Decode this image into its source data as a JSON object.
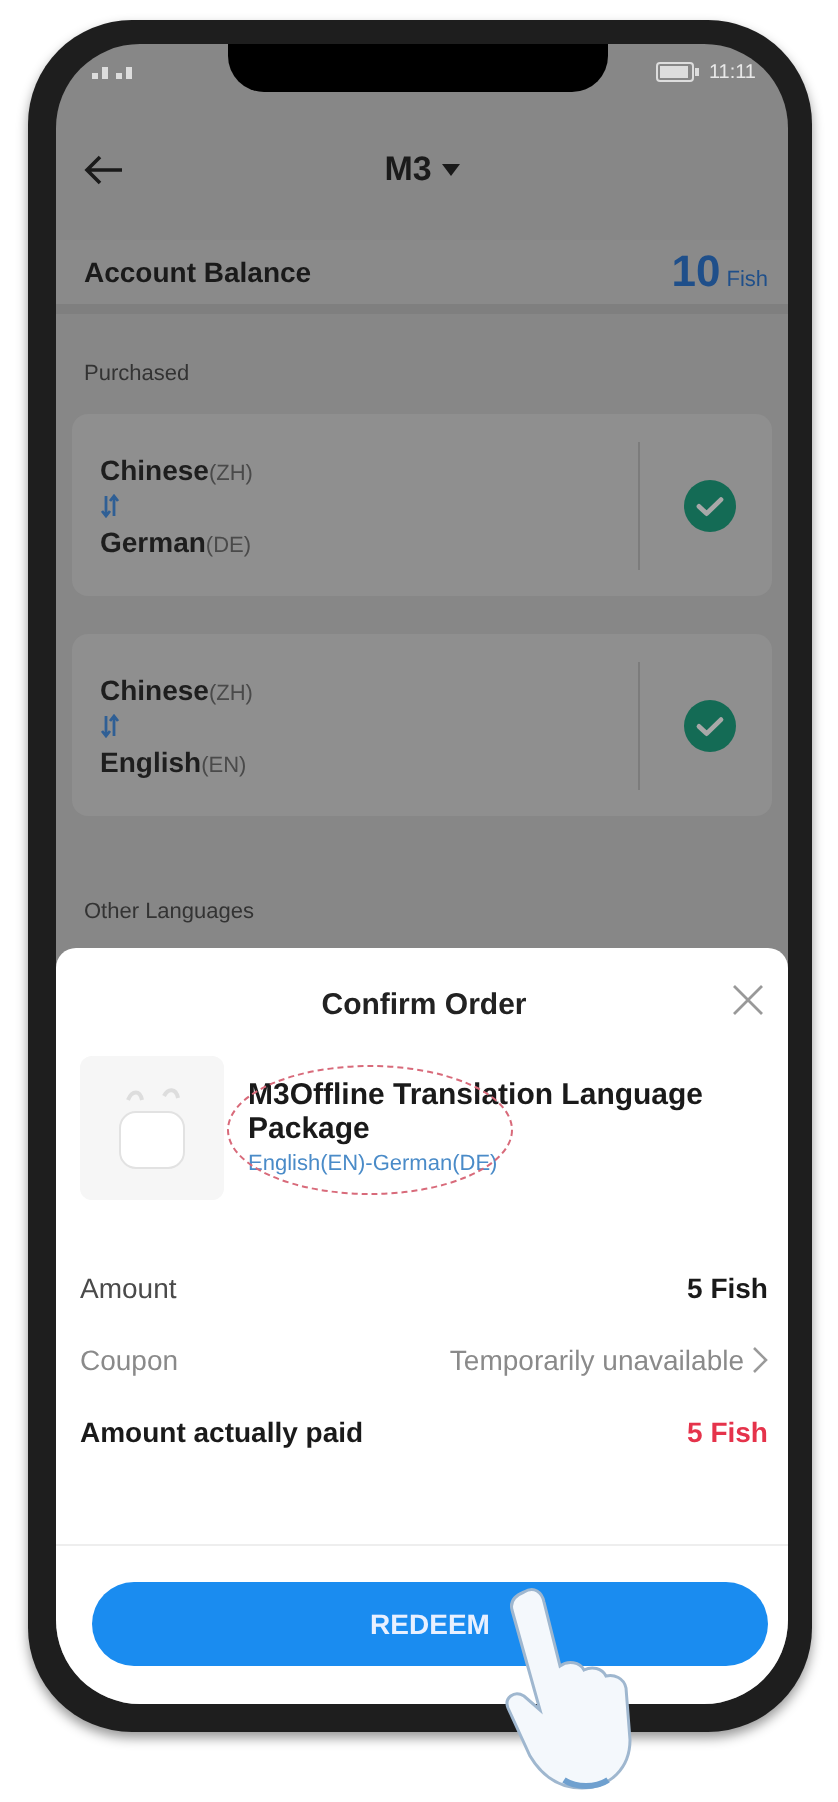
{
  "status_bar": {
    "time": "11:11"
  },
  "header": {
    "title": "M3"
  },
  "balance": {
    "label": "Account Balance",
    "amount": "10",
    "unit": "Fish"
  },
  "purchased": {
    "title": "Purchased",
    "packages": [
      {
        "from": {
          "name": "Chinese",
          "code": "(ZH)"
        },
        "to": {
          "name": "German",
          "code": "(DE)"
        },
        "purchased": true
      },
      {
        "from": {
          "name": "Chinese",
          "code": "(ZH)"
        },
        "to": {
          "name": "English",
          "code": "(EN)"
        },
        "purchased": true
      }
    ]
  },
  "other_languages": {
    "title": "Other Languages"
  },
  "order_sheet": {
    "title": "Confirm Order",
    "product": {
      "name": "M3Offline Translation Language Package",
      "languages": "English(EN)-German(DE)"
    },
    "rows": [
      {
        "label": "Amount",
        "value": "5 Fish",
        "kind": "plain"
      },
      {
        "label": "Coupon",
        "value": "Temporarily unavailable",
        "kind": "link"
      },
      {
        "label": "Amount actually paid",
        "value": "5 Fish",
        "kind": "total"
      }
    ],
    "button": "REDEEM"
  }
}
